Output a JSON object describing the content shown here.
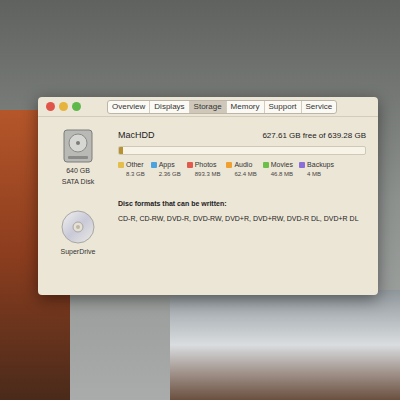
{
  "window": {
    "tabs": [
      {
        "label": "Overview",
        "selected": false
      },
      {
        "label": "Displays",
        "selected": false
      },
      {
        "label": "Storage",
        "selected": true
      },
      {
        "label": "Memory",
        "selected": false
      },
      {
        "label": "Support",
        "selected": false
      },
      {
        "label": "Service",
        "selected": false
      }
    ]
  },
  "disk": {
    "capacity": "640 GB",
    "type": "SATA Disk",
    "name": "MacHDD",
    "free": "627.61 GB free of 639.28 GB",
    "bar": {
      "level": 0.018
    },
    "legend": [
      {
        "label": "Other",
        "size": "8.3 GB",
        "color": "#e3be4a"
      },
      {
        "label": "Apps",
        "size": "2.36 GB",
        "color": "#4aa3df"
      },
      {
        "label": "Photos",
        "size": "893.3 MB",
        "color": "#e05a4e"
      },
      {
        "label": "Audio",
        "size": "62.4 MB",
        "color": "#f0a030"
      },
      {
        "label": "Movies",
        "size": "46.8 MB",
        "color": "#6cc04a"
      },
      {
        "label": "Backups",
        "size": "4 MB",
        "color": "#8a6fd8"
      }
    ]
  },
  "drive": {
    "name": "SuperDrive",
    "formats_title": "Disc formats that can be written:",
    "formats": "CD-R, CD-RW, DVD-R, DVD-RW, DVD+R, DVD+RW, DVD-R DL, DVD+R DL"
  }
}
